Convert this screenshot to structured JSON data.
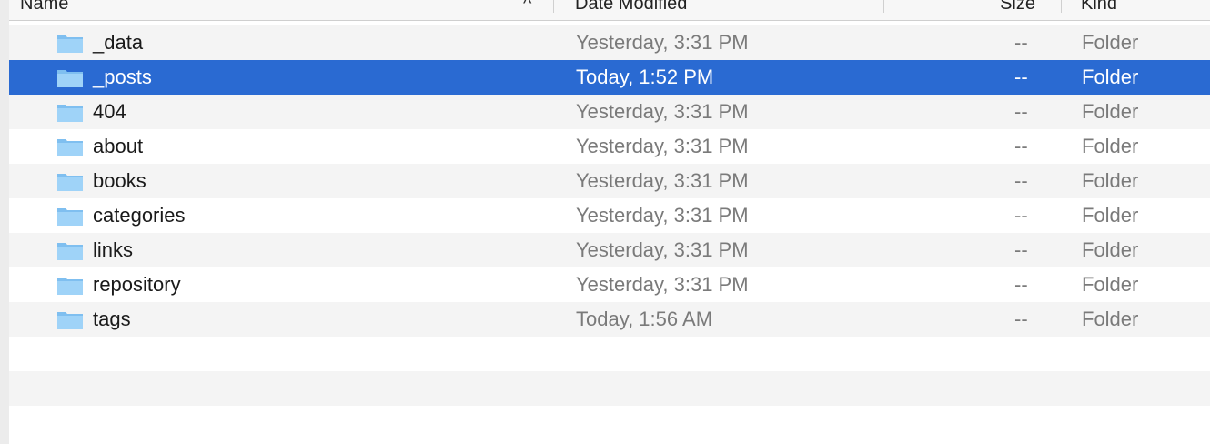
{
  "columns": {
    "name": "Name",
    "date": "Date Modified",
    "size": "Size",
    "kind": "Kind",
    "sort_glyph": "^"
  },
  "rows": [
    {
      "name": "_data",
      "date": "Yesterday, 3:31 PM",
      "size": "--",
      "kind": "Folder",
      "icon": "folder-icon"
    },
    {
      "name": "_posts",
      "date": "Today, 1:52 PM",
      "size": "--",
      "kind": "Folder",
      "icon": "folder-icon",
      "selected": true
    },
    {
      "name": "404",
      "date": "Yesterday, 3:31 PM",
      "size": "--",
      "kind": "Folder",
      "icon": "folder-icon"
    },
    {
      "name": "about",
      "date": "Yesterday, 3:31 PM",
      "size": "--",
      "kind": "Folder",
      "icon": "folder-icon"
    },
    {
      "name": "books",
      "date": "Yesterday, 3:31 PM",
      "size": "--",
      "kind": "Folder",
      "icon": "folder-icon"
    },
    {
      "name": "categories",
      "date": "Yesterday, 3:31 PM",
      "size": "--",
      "kind": "Folder",
      "icon": "folder-icon"
    },
    {
      "name": "links",
      "date": "Yesterday, 3:31 PM",
      "size": "--",
      "kind": "Folder",
      "icon": "folder-icon"
    },
    {
      "name": "repository",
      "date": "Yesterday, 3:31 PM",
      "size": "--",
      "kind": "Folder",
      "icon": "folder-icon"
    },
    {
      "name": "tags",
      "date": "Today, 1:56 AM",
      "size": "--",
      "kind": "Folder",
      "icon": "folder-icon"
    }
  ],
  "colors": {
    "selection": "#2a6ad2",
    "stripe": "#f4f4f4",
    "folder": "#8ec8f5"
  }
}
